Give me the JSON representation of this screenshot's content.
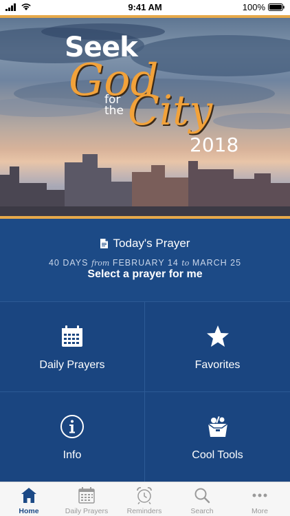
{
  "status_bar": {
    "time": "9:41 AM",
    "battery": "100%"
  },
  "hero": {
    "word1": "Seek",
    "word2": "God",
    "word3_line1": "for",
    "word3_line2": "the",
    "word4": "City",
    "year": "2018"
  },
  "prayer_panel": {
    "title": "Today's Prayer",
    "days_prefix": "40 DAYS",
    "from": "from",
    "start": "FEBRUARY 14",
    "to": "to",
    "end": "MARCH 25",
    "select_label": "Select a prayer for me"
  },
  "grid": [
    {
      "label": "Daily Prayers",
      "icon": "calendar-icon"
    },
    {
      "label": "Favorites",
      "icon": "star-icon"
    },
    {
      "label": "Info",
      "icon": "info-icon"
    },
    {
      "label": "Cool Tools",
      "icon": "toolbox-icon"
    }
  ],
  "tabs": [
    {
      "label": "Home",
      "icon": "home-icon",
      "active": true
    },
    {
      "label": "Daily Prayers",
      "icon": "calendar-icon",
      "active": false
    },
    {
      "label": "Reminders",
      "icon": "alarm-clock-icon",
      "active": false
    },
    {
      "label": "Search",
      "icon": "search-icon",
      "active": false
    },
    {
      "label": "More",
      "icon": "more-dots-icon",
      "active": false
    }
  ],
  "colors": {
    "primary": "#1c4a86",
    "accent": "#f2a23a",
    "tab_inactive": "#9a9a9a"
  }
}
